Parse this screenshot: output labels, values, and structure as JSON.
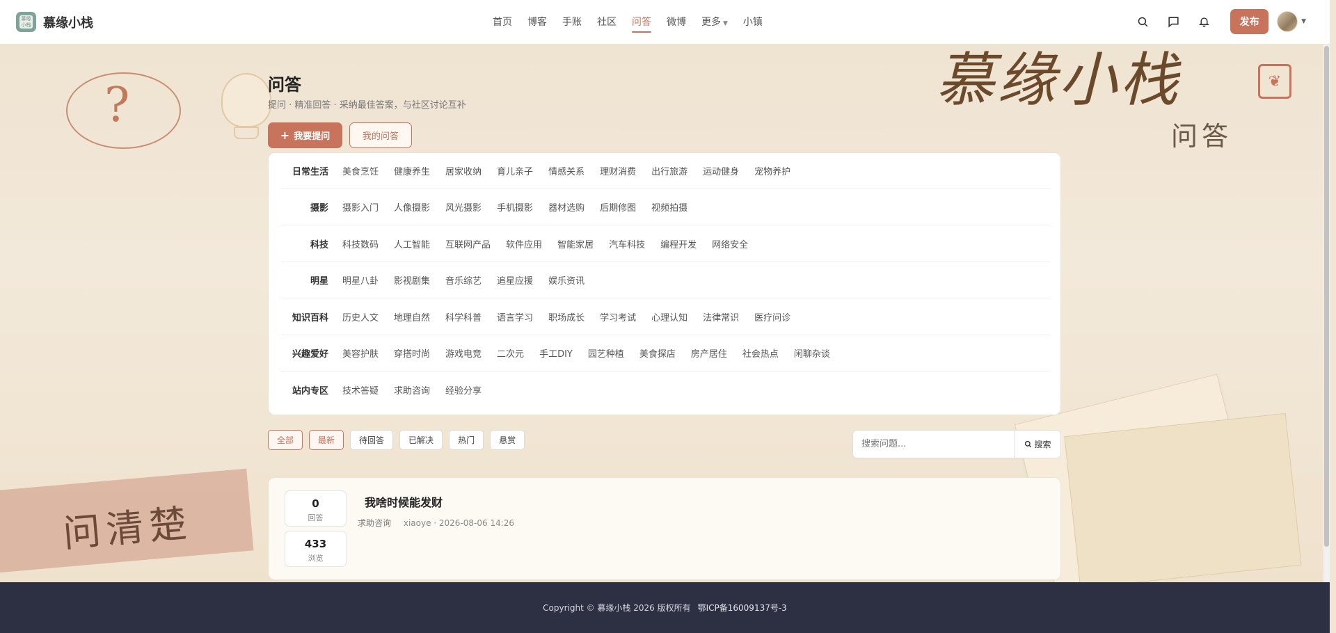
{
  "header": {
    "site_name": "慕缘小栈",
    "logo_text": "慕缘小栈",
    "nav": [
      {
        "label": "首页",
        "active": false
      },
      {
        "label": "博客",
        "active": false
      },
      {
        "label": "手账",
        "active": false
      },
      {
        "label": "社区",
        "active": false
      },
      {
        "label": "问答",
        "active": true
      },
      {
        "label": "微博",
        "active": false
      },
      {
        "label": "更多",
        "active": false,
        "dropdown": true
      },
      {
        "label": "小镇",
        "active": false
      }
    ],
    "publish_label": "发布",
    "icons": [
      "search-icon",
      "message-icon",
      "bell-icon"
    ]
  },
  "banner": {
    "big_title": "慕缘小栈",
    "subtitle_art": "问答",
    "tape_text": "问清楚"
  },
  "page": {
    "title": "问答",
    "subtitle": "提问 · 精准回答 · 采纳最佳答案，与社区讨论互补",
    "ask_label": "我要提问",
    "mine_label": "我的问答"
  },
  "categories": [
    {
      "name": "日常生活",
      "tags": [
        "美食烹饪",
        "健康养生",
        "居家收纳",
        "育儿亲子",
        "情感关系",
        "理财消费",
        "出行旅游",
        "运动健身",
        "宠物养护"
      ]
    },
    {
      "name": "摄影",
      "tags": [
        "摄影入门",
        "人像摄影",
        "风光摄影",
        "手机摄影",
        "器材选购",
        "后期修图",
        "视频拍摄"
      ]
    },
    {
      "name": "科技",
      "tags": [
        "科技数码",
        "人工智能",
        "互联网产品",
        "软件应用",
        "智能家居",
        "汽车科技",
        "编程开发",
        "网络安全"
      ]
    },
    {
      "name": "明星",
      "tags": [
        "明星八卦",
        "影视剧集",
        "音乐综艺",
        "追星应援",
        "娱乐资讯"
      ]
    },
    {
      "name": "知识百科",
      "tags": [
        "历史人文",
        "地理自然",
        "科学科普",
        "语言学习",
        "职场成长",
        "学习考试",
        "心理认知",
        "法律常识",
        "医疗问诊"
      ]
    },
    {
      "name": "兴趣爱好",
      "tags": [
        "美容护肤",
        "穿搭时尚",
        "游戏电竞",
        "二次元",
        "手工DIY",
        "园艺种植",
        "美食探店",
        "房产居住",
        "社会热点",
        "闲聊杂谈"
      ]
    },
    {
      "name": "站内专区",
      "tags": [
        "技术答疑",
        "求助咨询",
        "经验分享"
      ]
    }
  ],
  "filters": [
    {
      "label": "全部",
      "active": true
    },
    {
      "label": "最新",
      "active": true
    },
    {
      "label": "待回答",
      "active": false
    },
    {
      "label": "已解决",
      "active": false
    },
    {
      "label": "热门",
      "active": false
    },
    {
      "label": "悬赏",
      "active": false
    }
  ],
  "search": {
    "placeholder": "搜索问题...",
    "button_label": "搜索"
  },
  "questions": [
    {
      "title": "我啥时候能发财",
      "category": "求助咨询",
      "author_time": "xiaoye · 2026-08-06 14:26",
      "answers": "0",
      "answers_label": "回答",
      "views": "433",
      "views_label": "浏览"
    }
  ],
  "footer": {
    "copyright": "Copyright © 慕缘小栈 2026 版权所有",
    "icp": "鄂ICP备16009137号-3"
  },
  "colors": {
    "accent": "#c8735c",
    "footer_bg": "#2d2f42",
    "page_bg": "#f1e6d6"
  }
}
